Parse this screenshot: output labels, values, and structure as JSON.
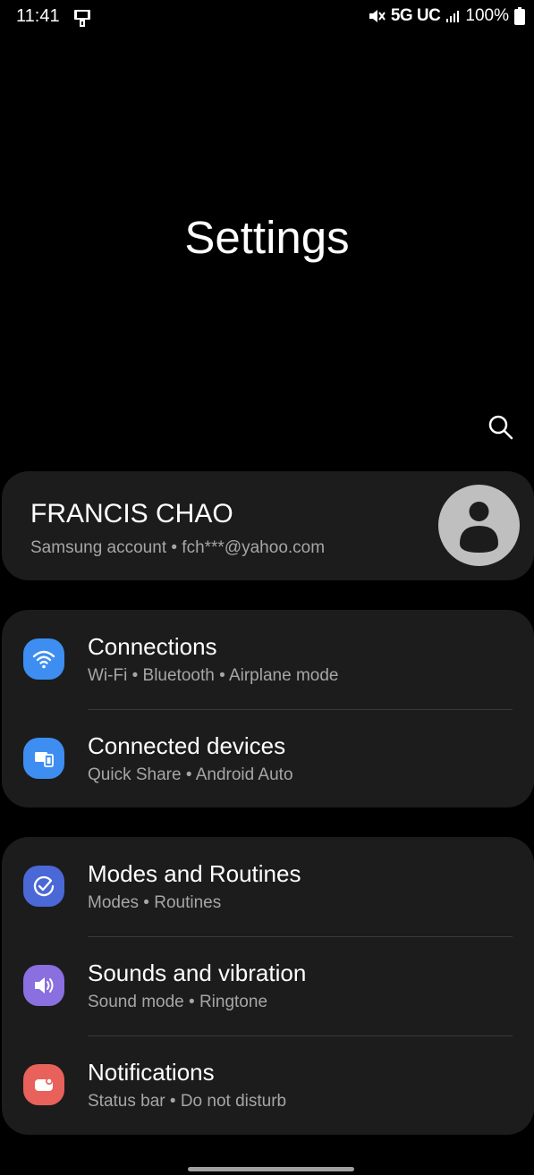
{
  "status_bar": {
    "time": "11:41",
    "network": "5G UC",
    "battery": "100%"
  },
  "page": {
    "title": "Settings"
  },
  "account": {
    "name": "FRANCIS CHAO",
    "subtitle": "Samsung account  •  fch***@yahoo.com"
  },
  "groups": [
    {
      "items": [
        {
          "title": "Connections",
          "subtitle": "Wi-Fi  •  Bluetooth  •  Airplane mode",
          "icon": "wifi-icon",
          "color": "#3d8ef0"
        },
        {
          "title": "Connected devices",
          "subtitle": "Quick Share  •  Android Auto",
          "icon": "devices-icon",
          "color": "#3d8ef0"
        }
      ]
    },
    {
      "items": [
        {
          "title": "Modes and Routines",
          "subtitle": "Modes  •  Routines",
          "icon": "check-circle-icon",
          "color": "#4a68d6"
        },
        {
          "title": "Sounds and vibration",
          "subtitle": "Sound mode  •  Ringtone",
          "icon": "speaker-icon",
          "color": "#8a6fe0"
        },
        {
          "title": "Notifications",
          "subtitle": "Status bar  •  Do not disturb",
          "icon": "notification-icon",
          "color": "#e8615a"
        }
      ]
    }
  ],
  "colors": {
    "background": "#000000",
    "card": "#1c1c1c",
    "secondary_text": "#a6a6a6",
    "avatar": "#bfbfbf"
  }
}
